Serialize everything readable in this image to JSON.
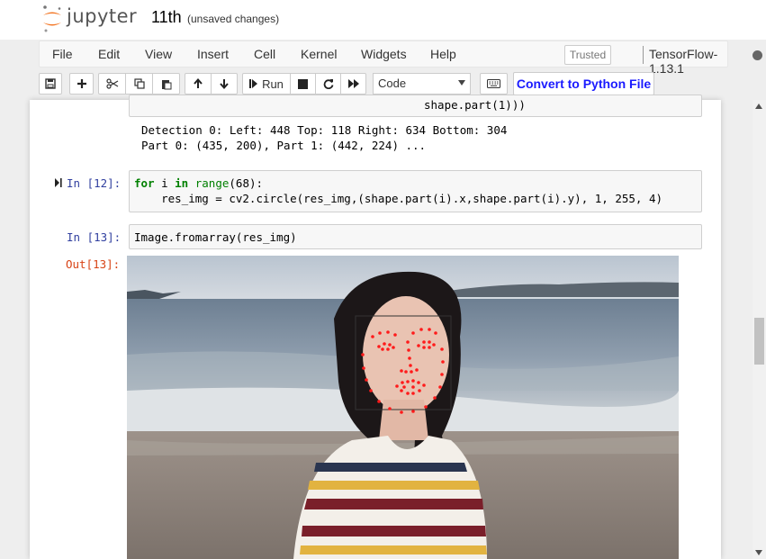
{
  "header": {
    "logo_text": "jupyter",
    "notebook_name": "11th",
    "save_status": "(unsaved changes)"
  },
  "menubar": {
    "items": [
      "File",
      "Edit",
      "View",
      "Insert",
      "Cell",
      "Kernel",
      "Widgets",
      "Help"
    ],
    "trusted": "Trusted",
    "kernel_name": "TensorFlow-1.13.1"
  },
  "toolbar": {
    "run_label": "Run",
    "cell_type": "Code",
    "convert_label": "Convert to Python File",
    "icons": [
      "save-icon",
      "plus-icon",
      "cut-icon",
      "copy-icon",
      "paste-icon",
      "arrow-up-icon",
      "arrow-down-icon",
      "step-forward-icon",
      "stop-icon",
      "restart-icon",
      "fast-forward-icon",
      "keyboard-icon"
    ]
  },
  "cells": {
    "prev_code_tail": "shape.part(1)))",
    "prev_output_line1": "Detection 0: Left: 448 Top: 118 Right: 634 Bottom: 304",
    "prev_output_line2": "Part 0: (435, 200), Part 1: (442, 224) ...",
    "cell12": {
      "prompt": "In  [12]:",
      "line1_kw": "for",
      "line1_var": " i ",
      "line1_in": "in",
      "line1_range": "range",
      "line1_arg": "(68):",
      "line2": "    res_img = cv2.circle(res_img,(shape.part(i).x,shape.part(i).y), 1, 255, 4)"
    },
    "cell13": {
      "prompt": "In  [13]:",
      "code": "Image.fromarray(res_img)",
      "out_prompt": "Out[13]:"
    }
  },
  "colors": {
    "accent_link": "#1a1aff",
    "prompt_in": "#303f9f",
    "prompt_out": "#d84315",
    "landmark": "#ff0000"
  }
}
